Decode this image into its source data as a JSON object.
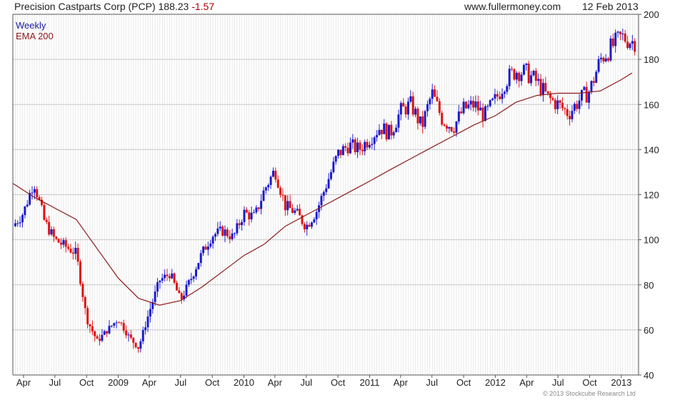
{
  "header": {
    "title": "Precision Castparts Corp (PCP) 188.23",
    "change": "-1.57",
    "site": "www.fullermoney.com",
    "date": "12 Feb 2013"
  },
  "legend": {
    "series1": "Weekly",
    "series2": "EMA 200"
  },
  "copyright": "© 2013 Stockcube Research Ltd",
  "colors": {
    "up": "#1a1acc",
    "down": "#dd1111",
    "ema": "#8b1a1a",
    "grid": "#d4d4d4"
  },
  "chart_data": {
    "type": "line",
    "title": "Precision Castparts Corp (PCP) 188.23 -1.57",
    "ylim": [
      40,
      200
    ],
    "grid": true,
    "y_ticks": [
      40,
      60,
      80,
      100,
      120,
      140,
      160,
      180,
      200
    ],
    "x_ticks": [
      {
        "label": "Apr",
        "x": "2008-04"
      },
      {
        "label": "Jul",
        "x": "2008-07"
      },
      {
        "label": "Oct",
        "x": "2008-10"
      },
      {
        "label": "2009",
        "x": "2009-01"
      },
      {
        "label": "Apr",
        "x": "2009-04"
      },
      {
        "label": "Jul",
        "x": "2009-07"
      },
      {
        "label": "Oct",
        "x": "2009-10"
      },
      {
        "label": "2010",
        "x": "2010-01"
      },
      {
        "label": "Apr",
        "x": "2010-04"
      },
      {
        "label": "Jul",
        "x": "2010-07"
      },
      {
        "label": "Oct",
        "x": "2010-10"
      },
      {
        "label": "2011",
        "x": "2011-01"
      },
      {
        "label": "Apr",
        "x": "2011-04"
      },
      {
        "label": "Jul",
        "x": "2011-07"
      },
      {
        "label": "Oct",
        "x": "2011-10"
      },
      {
        "label": "2012",
        "x": "2012-01"
      },
      {
        "label": "Apr",
        "x": "2012-04"
      },
      {
        "label": "Jul",
        "x": "2012-07"
      },
      {
        "label": "Oct",
        "x": "2012-10"
      },
      {
        "label": "2013",
        "x": "2013-01"
      }
    ],
    "series": [
      {
        "name": "Weekly",
        "x": [
          "2008-03-01",
          "2008-04-01",
          "2008-05-01",
          "2008-06-01",
          "2008-07-01",
          "2008-08-01",
          "2008-09-01",
          "2008-10-01",
          "2008-11-01",
          "2008-12-01",
          "2009-01-01",
          "2009-02-01",
          "2009-03-01",
          "2009-04-01",
          "2009-05-01",
          "2009-06-01",
          "2009-07-01",
          "2009-08-01",
          "2009-09-01",
          "2009-10-01",
          "2009-11-01",
          "2009-12-01",
          "2010-01-01",
          "2010-02-01",
          "2010-03-01",
          "2010-04-01",
          "2010-05-01",
          "2010-06-01",
          "2010-07-01",
          "2010-08-01",
          "2010-09-01",
          "2010-10-01",
          "2010-11-01",
          "2010-12-01",
          "2011-01-01",
          "2011-02-01",
          "2011-03-01",
          "2011-04-01",
          "2011-05-01",
          "2011-06-01",
          "2011-07-01",
          "2011-08-01",
          "2011-09-01",
          "2011-10-01",
          "2011-11-01",
          "2011-12-01",
          "2012-01-01",
          "2012-02-01",
          "2012-03-01",
          "2012-04-01",
          "2012-05-01",
          "2012-06-01",
          "2012-07-01",
          "2012-08-01",
          "2012-09-01",
          "2012-10-01",
          "2012-11-01",
          "2012-12-01",
          "2013-01-01",
          "2013-02-01"
        ],
        "values": [
          106,
          112,
          126,
          108,
          100,
          97,
          94,
          65,
          55,
          60,
          65,
          57,
          52,
          68,
          82,
          85,
          73,
          83,
          94,
          102,
          104,
          101,
          112,
          110,
          122,
          131,
          115,
          112,
          106,
          113,
          126,
          138,
          142,
          140,
          145,
          150,
          147,
          157,
          160,
          150,
          165,
          153,
          150,
          158,
          160,
          155,
          162,
          171,
          175,
          174,
          170,
          163,
          160,
          156,
          162,
          166,
          180,
          185,
          190,
          188
        ]
      },
      {
        "name": "EMA 200",
        "x": [
          "2008-03-01",
          "2008-05-01",
          "2008-07-01",
          "2008-09-01",
          "2008-11-01",
          "2009-01-01",
          "2009-03-01",
          "2009-05-01",
          "2009-07-01",
          "2009-09-01",
          "2009-11-01",
          "2010-01-01",
          "2010-03-01",
          "2010-05-01",
          "2010-07-01",
          "2010-09-01",
          "2010-11-01",
          "2011-01-01",
          "2011-03-01",
          "2011-05-01",
          "2011-07-01",
          "2011-09-01",
          "2011-11-01",
          "2012-01-01",
          "2012-03-01",
          "2012-05-01",
          "2012-07-01",
          "2012-09-01",
          "2012-11-01",
          "2013-01-01",
          "2013-02-01"
        ],
        "values": [
          125,
          119,
          114,
          109,
          96,
          83,
          74,
          71,
          73,
          79,
          86,
          93,
          98,
          106,
          111,
          116,
          121,
          126,
          131,
          136,
          141,
          146,
          151,
          155,
          161,
          164,
          165,
          165,
          166,
          171,
          174
        ]
      }
    ]
  }
}
